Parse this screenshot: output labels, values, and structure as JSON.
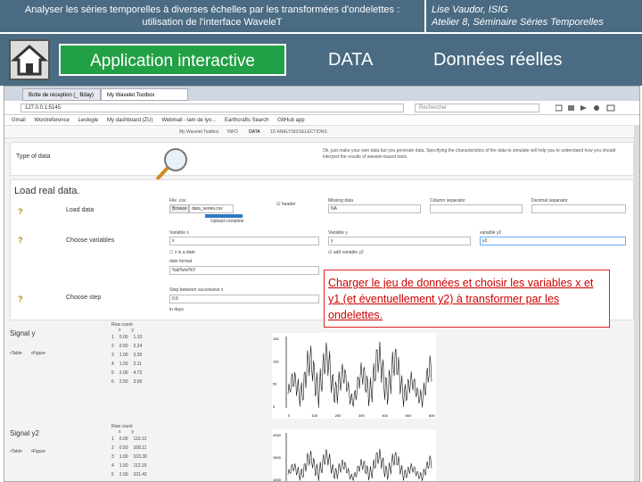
{
  "header": {
    "title_line1": "Analyser les séries temporelles à diverses échelles par les transformées d'ondelettes :",
    "title_line2": "utilisation de l'interface WaveleT",
    "author_line1": "Lise Vaudor, ISIG",
    "author_line2": "Atelier 8, Séminaire Séries Temporelles"
  },
  "nav": {
    "app_label": "Application interactive",
    "data_label": "DATA",
    "real_label": "Données réelles"
  },
  "browser": {
    "tab1": "Boîte de réception (_ Bday) ...",
    "tab2": "My Wavelet Toolbox",
    "url": "127.0.0.1:5145",
    "search_placeholder": "Rechercher",
    "bookmarks": [
      "Gmail",
      "Wordreference",
      "Leologie",
      "My dashboard (ZU)",
      "Webmail - lam de lyo...",
      "Earthcrafts Search",
      "GitHub app"
    ]
  },
  "app": {
    "tabs": [
      "My Wavelet Toolbox",
      "INFO",
      "DATA",
      "1D ANALYSIS",
      "SELECTIONS"
    ],
    "type_label": "Type of data",
    "load_title": "Load real data.",
    "load_data": "Load data",
    "choose_vars": "Choose variables",
    "choose_step": "Choose step",
    "info_text": "Ok, just make your own data but you generate data. Specifying the characteristics of the data to simulate will help you to understand how you should interpret the results of wavelet-based tools.",
    "csv_label": "File .csv",
    "browse": "Browse",
    "file_name": "data_series.csv",
    "upload_done": "Upload complete",
    "header_label": "header",
    "sep_label": "Column separator",
    "dec_label": "Decimal separator",
    "missing_label": "Missing data",
    "missing_val": "NA",
    "var_x": "Variable x",
    "var_x_val": "x",
    "var_y": "Variable y",
    "var_y_val": "y",
    "var_y2": "variable y2",
    "var_y2_val": "y2",
    "is_date": "x is a date",
    "add_y2": "add variable y2",
    "date_format": "date format",
    "date_format_val": "%d/%m/%Y",
    "step_label": "Step between successive x",
    "step_val": "0.5",
    "step_unit": "in days",
    "signal_y": "Signal y",
    "signal_y2": "Signal y2",
    "table_btn": "Table",
    "figure_btn": "Figure",
    "row_label": "Row count",
    "col_x": "x",
    "col_y": "y",
    "rows": [
      [
        "0.00",
        "1.10"
      ],
      [
        "0.50",
        "2.24"
      ],
      [
        "1.00",
        "3.35"
      ],
      [
        "1.50",
        "2.11"
      ],
      [
        "2.00",
        "4.72"
      ],
      [
        "2.50",
        "3.09"
      ]
    ],
    "rows2": [
      [
        "0.00",
        "110.12"
      ],
      [
        "0.50",
        "108.11"
      ],
      [
        "1.00",
        "103.30"
      ],
      [
        "1.50",
        "112.15"
      ],
      [
        "2.00",
        "101.42"
      ]
    ]
  },
  "callout": "Charger le jeu de données et choisir les variables x et y1 (et éventuellement y2) à transformer par les ondelettes.",
  "plot1": {
    "yticks": [
      "150",
      "100",
      "50",
      "0"
    ],
    "xticks": [
      "0",
      "100",
      "200",
      "300",
      "400",
      "500",
      "600"
    ]
  },
  "plot2": {
    "yticks": [
      "2000",
      "1500",
      "1000"
    ]
  }
}
